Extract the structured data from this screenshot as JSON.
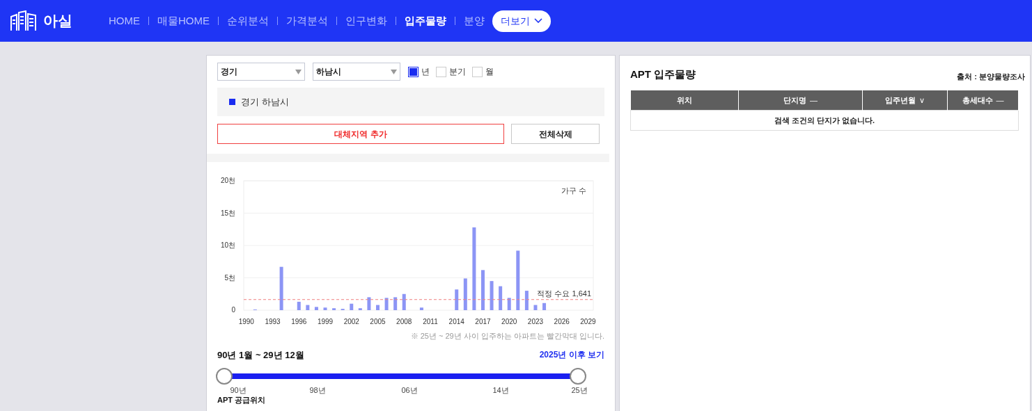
{
  "header": {
    "logo_text": "아실",
    "nav": [
      {
        "label": "HOME",
        "selected": false
      },
      {
        "label": "매물HOME",
        "selected": false
      },
      {
        "label": "순위분석",
        "selected": false
      },
      {
        "label": "가격분석",
        "selected": false
      },
      {
        "label": "인구변화",
        "selected": false
      },
      {
        "label": "입주물량",
        "selected": true
      },
      {
        "label": "분양",
        "selected": false
      }
    ],
    "more_button": "더보기"
  },
  "left_panel": {
    "selects": [
      {
        "value": "경기"
      },
      {
        "value": "하남시"
      }
    ],
    "period_options": [
      {
        "label": "년",
        "selected": true
      },
      {
        "label": "분기",
        "selected": false
      },
      {
        "label": "월",
        "selected": false
      }
    ],
    "regions": [
      {
        "label": "경기 하남시",
        "color": "#1a2cf0"
      }
    ],
    "add_button": "대체지역 추가",
    "clear_button": "전체삭제",
    "chart_data": {
      "type": "bar",
      "grid": true,
      "x": [
        1991,
        1994,
        1996,
        1997,
        1998,
        1999,
        2000,
        2001,
        2002,
        2003,
        2004,
        2005,
        2006,
        2007,
        2008,
        2010,
        2014,
        2015,
        2016,
        2017,
        2018,
        2019,
        2020,
        2021,
        2022,
        2023,
        2024
      ],
      "ylabel": "가구 수",
      "series": [
        {
          "color": "#8c95f5",
          "values": [
            0.1,
            6.7,
            1.3,
            0.8,
            0.5,
            0.4,
            0.3,
            0.2,
            1.0,
            0.3,
            2.0,
            0.8,
            1.9,
            2.0,
            2.5,
            0.4,
            3.2,
            4.9,
            12.8,
            6.2,
            4.5,
            3.7,
            1.9,
            9.2,
            3.0,
            0.8,
            1.1
          ]
        }
      ],
      "xlim": [
        1989.7,
        2029.6
      ],
      "ylim": [
        0,
        20
      ],
      "yticks": [
        {
          "value": 0,
          "label": "0"
        },
        {
          "value": 5,
          "label": "5천"
        },
        {
          "value": 10,
          "label": "10천"
        },
        {
          "value": 15,
          "label": "15천"
        },
        {
          "value": 20,
          "label": "20천"
        }
      ],
      "xticks": [
        1990,
        1993,
        1996,
        1999,
        2002,
        2005,
        2008,
        2011,
        2014,
        2017,
        2020,
        2023,
        2026,
        2029
      ],
      "ref_lines": [
        {
          "axis": "y",
          "value": 1.641,
          "label": "적정 수요 1,641",
          "color": "#f08080"
        }
      ]
    },
    "chart_note": "※ 25년 ~ 29년 사이 입주하는 아파트는 빨간막대 입니다.",
    "range_label": "90년 1월 ~ 29년 12월",
    "future_link": "2025년 이후 보기",
    "slider": {
      "handles": [
        {
          "level": 0
        },
        {
          "level": 1
        }
      ],
      "ticks": [
        "90년",
        "98년",
        "06년",
        "14년",
        "25년"
      ]
    },
    "next_section_title": "APT 공급위치"
  },
  "right_panel": {
    "title": "APT 입주물량",
    "source": "출처 : 분양물량조사",
    "table": {
      "columns": [
        {
          "label": "위치"
        },
        {
          "label": "단지명",
          "sort_mark": "—"
        },
        {
          "label": "입주년월",
          "sort_mark": "∨"
        },
        {
          "label": "총세대수",
          "sort_mark": "—"
        }
      ],
      "empty_message": "검색 조건의 단지가 없습니다."
    }
  }
}
